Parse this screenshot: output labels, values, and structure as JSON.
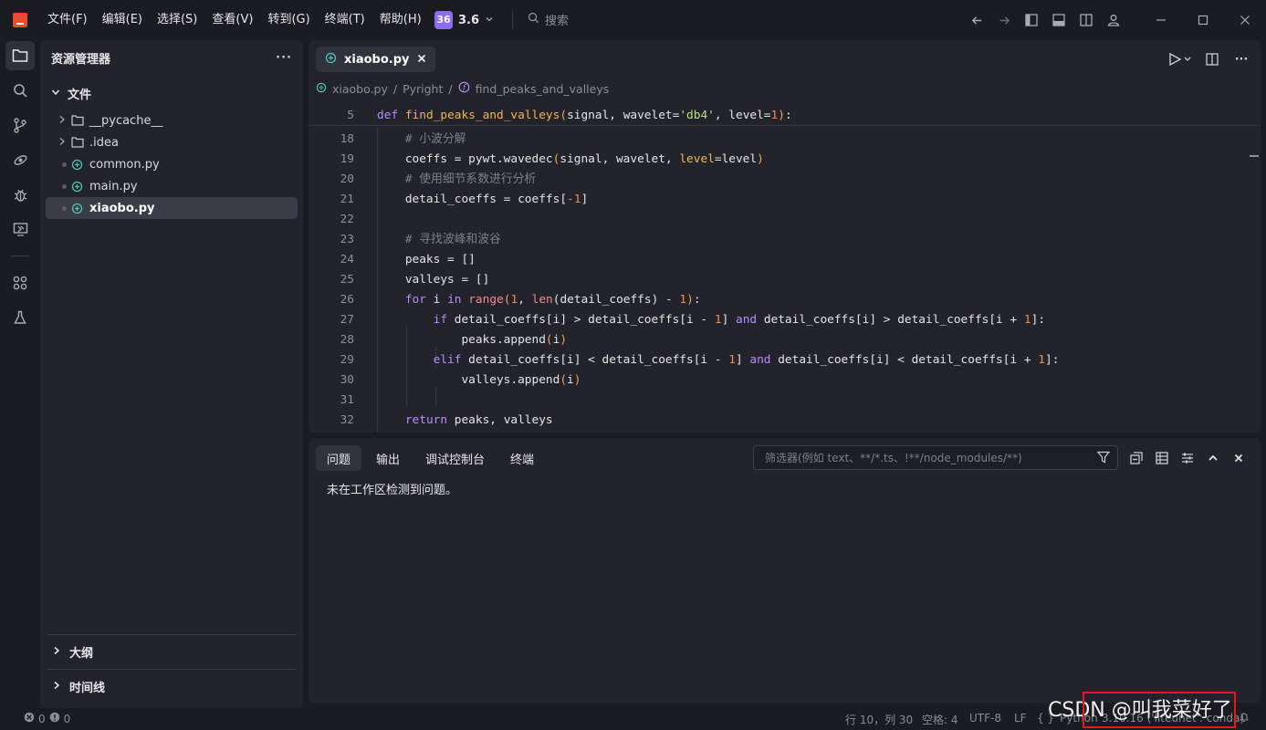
{
  "titlebar": {
    "menu": [
      "文件(F)",
      "编辑(E)",
      "选择(S)",
      "查看(V)",
      "转到(G)",
      "终端(T)",
      "帮助(H)"
    ],
    "version_icon": "36",
    "version": "3.6",
    "search_placeholder": "搜索"
  },
  "sidebar": {
    "title": "资源管理器",
    "section": "文件",
    "items": [
      {
        "name": "__pycache__",
        "type": "folder"
      },
      {
        "name": ".idea",
        "type": "folder"
      },
      {
        "name": "common.py",
        "type": "python"
      },
      {
        "name": "main.py",
        "type": "python"
      },
      {
        "name": "xiaobo.py",
        "type": "python",
        "selected": true
      }
    ],
    "outline": "大纲",
    "timeline": "时间线"
  },
  "editor": {
    "tab": "xiaobo.py",
    "breadcrumb": [
      "xiaobo.py",
      "Pyright",
      "find_peaks_and_valleys"
    ],
    "sticky_line_number": "5",
    "line_numbers": [
      "18",
      "19",
      "20",
      "21",
      "22",
      "23",
      "24",
      "25",
      "26",
      "27",
      "28",
      "29",
      "30",
      "31",
      "32"
    ]
  },
  "panel": {
    "tabs": [
      "问题",
      "输出",
      "调试控制台",
      "终端"
    ],
    "filter_placeholder": "筛选器(例如 text、**/*.ts、!**/node_modules/**)",
    "message": "未在工作区检测到问题。"
  },
  "statusbar": {
    "errors": "0",
    "warnings": "0",
    "position": "行 10，列 30",
    "spaces": "空格: 4",
    "encoding": "UTF-8",
    "eol": "LF",
    "language": "Python",
    "interpreter": "3.10.16 ('liteunet': conda)"
  },
  "watermark": "CSDN @叫我菜好了",
  "colors": {
    "accent": "#8c6cf5",
    "logo": "#ee4a2d",
    "keyword": "#b68cff",
    "function": "#f0b35a",
    "string": "#b6e27a",
    "number": "#f08a5d"
  }
}
